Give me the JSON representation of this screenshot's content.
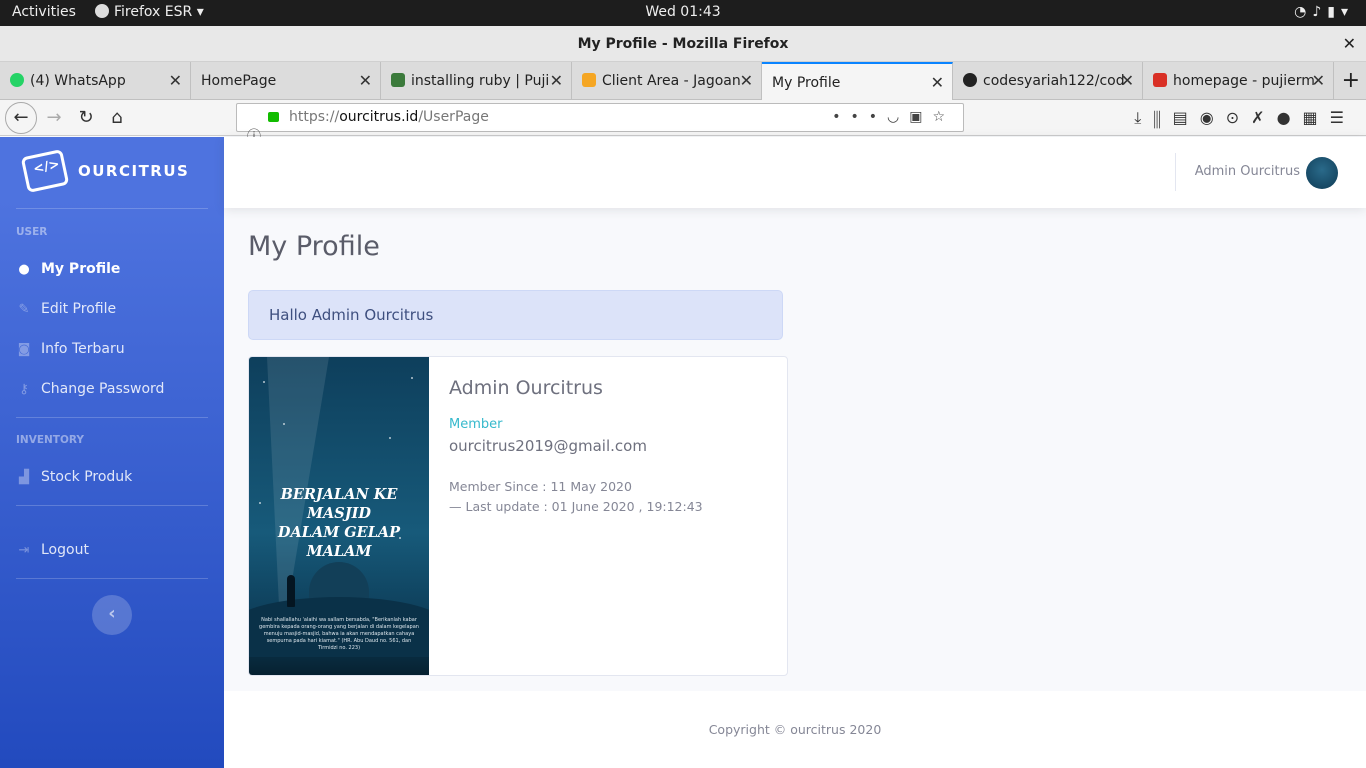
{
  "os": {
    "activities": "Activities",
    "app_name": "Firefox ESR",
    "clock": "Wed 01:43"
  },
  "window": {
    "title": "My Profile - Mozilla Firefox"
  },
  "tabs": [
    {
      "label": "(4) WhatsApp",
      "icon": "whatsapp-icon",
      "color": "#25d366"
    },
    {
      "label": "HomePage",
      "icon": "page-icon",
      "color": "#dcdcdc"
    },
    {
      "label": "installing ruby | Puji",
      "icon": "document-icon",
      "color": "#3b7a3b"
    },
    {
      "label": "Client Area - Jagoan",
      "icon": "jagoan-icon",
      "color": "#f5a623"
    },
    {
      "label": "My Profile",
      "icon": "page-icon",
      "color": "#f5f5f5"
    },
    {
      "label": "codesyariah122/cod",
      "icon": "github-icon",
      "color": "#222222"
    },
    {
      "label": "homepage - pujierm",
      "icon": "gmail-icon",
      "color": "#d93025"
    }
  ],
  "address": {
    "scheme": "https://",
    "host": "ourcitrus.id",
    "path": "/UserPage"
  },
  "app": {
    "brand": "OURCITRUS",
    "sections": [
      {
        "heading": "USER"
      },
      {
        "heading": "INVENTORY"
      }
    ],
    "nav": {
      "my_profile": "My Profile",
      "edit_profile": "Edit Profile",
      "info_terbaru": "Info Terbaru",
      "change_password": "Change Password",
      "stock_produk": "Stock Produk",
      "logout": "Logout"
    },
    "topbar_user": "Admin Ourcitrus"
  },
  "page": {
    "title": "My Profile",
    "greeting": "Hallo Admin Ourcitrus",
    "profile": {
      "name": "Admin Ourcitrus",
      "role": "Member",
      "email": "ourcitrus2019@gmail.com",
      "member_since": "Member Since : 11 May 2020",
      "last_update": "— Last update : 01 June 2020 , 19:12:43"
    },
    "poster": {
      "title_line1": "BERJALAN KE MASJID",
      "title_line2": "DALAM GELAP MALAM",
      "quote": "Nabi shallallahu 'alaihi wa sallam bersabda, \"Berikanlah kabar gembira kepada orang-orang yang berjalan di dalam kegelapan menuju masjid-masjid, bahwa ia akan mendapatkan cahaya sempurna pada hari kiamat.\" (HR. Abu Daud no. 561, dan Tirmidzi no. 223)"
    }
  },
  "footer": {
    "copyright": "Copyright © ourcitrus 2020"
  },
  "colors": {
    "sidebar_start": "#4e73df",
    "sidebar_end": "#224abe",
    "accent_info": "#36b9cc",
    "alert_bg": "#dce3f9"
  }
}
